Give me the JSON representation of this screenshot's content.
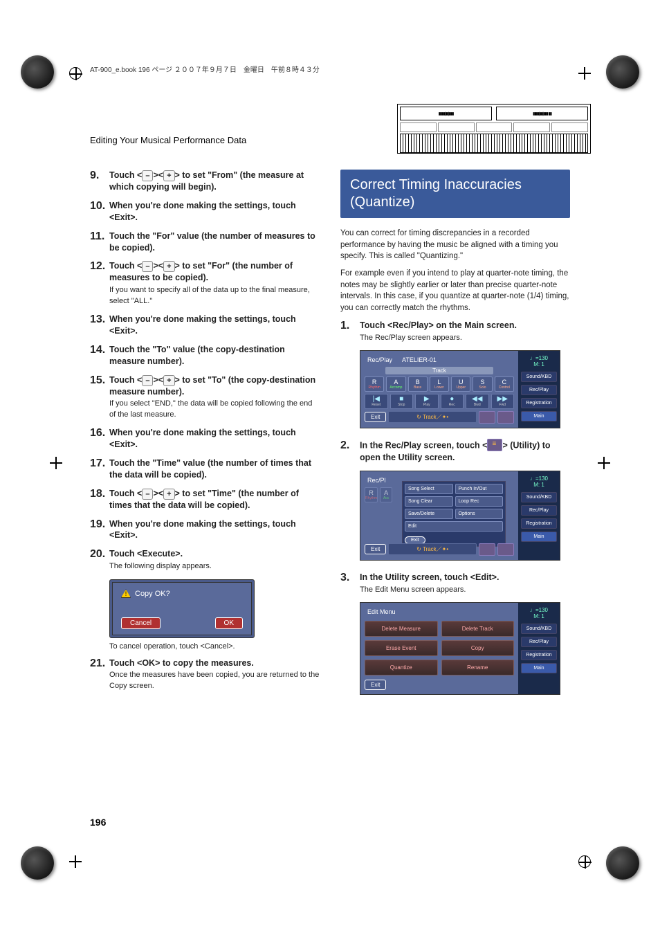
{
  "header": "AT-900_e.book  196 ページ  ２００７年９月７日　金曜日　午前８時４３分",
  "sectionTitle": "Editing Your Musical Performance Data",
  "pageNumber": "196",
  "left": {
    "steps": {
      "s9": {
        "num": "9.",
        "bold": "Touch < – >< + > to set \"From\" (the measure at which copying will begin)."
      },
      "s10": {
        "num": "10.",
        "bold": "When you're done making the settings, touch <Exit>."
      },
      "s11": {
        "num": "11.",
        "bold": "Touch the \"For\" value (the number of measures to be copied)."
      },
      "s12": {
        "num": "12.",
        "bold": "Touch < – >< + > to set \"For\" (the number of measures to be copied).",
        "note": "If you want to specify all of the data up to the final measure, select \"ALL.\""
      },
      "s13": {
        "num": "13.",
        "bold": "When you're done making the settings, touch <Exit>."
      },
      "s14": {
        "num": "14.",
        "bold": "Touch the \"To\" value (the copy-destination measure number)."
      },
      "s15": {
        "num": "15.",
        "bold": "Touch < – >< + > to set \"To\" (the copy-destination measure number).",
        "note": "If you select \"END,\" the data will be copied following the end of the last measure."
      },
      "s16": {
        "num": "16.",
        "bold": "When you're done making the settings, touch <Exit>."
      },
      "s17": {
        "num": "17.",
        "bold": "Touch the \"Time\" value (the number of times that the data will be copied)."
      },
      "s18": {
        "num": "18.",
        "bold": "Touch < – >< + > to set \"Time\" (the number of times that the data will be copied)."
      },
      "s19": {
        "num": "19.",
        "bold": "When you're done making the settings, touch <Exit>."
      },
      "s20": {
        "num": "20.",
        "bold": "Touch <Execute>.",
        "caption": "The following display appears."
      },
      "s21": {
        "num": "21.",
        "bold": "Touch <OK> to copy the measures.",
        "note": "Once the measures have been copied, you are returned to the Copy screen."
      }
    },
    "dialog": {
      "title": "Copy OK?",
      "cancel": "Cancel",
      "ok": "OK",
      "cancelCaption": "To cancel operation, touch <Cancel>."
    }
  },
  "right": {
    "heading": "Correct Timing Inaccuracies (Quantize)",
    "para1": "You can correct for timing discrepancies in a recorded performance by having the music be aligned with a timing you specify. This is called \"Quantizing.\"",
    "para2": "For example even if you intend to play at quarter-note timing, the notes may be slightly earlier or later than precise quarter-note intervals. In this case, if you quantize at quarter-note (1/4) timing, you can correctly match the rhythms.",
    "steps": {
      "s1": {
        "num": "1.",
        "bold": "Touch <Rec/Play> on the Main screen.",
        "caption": "The Rec/Play screen appears."
      },
      "s2": {
        "num": "2.",
        "boldA": "In the Rec/Play screen, touch <",
        "boldB": "> (Utility) to open the Utility screen."
      },
      "s3": {
        "num": "3.",
        "bold": "In the Utility screen, touch <Edit>.",
        "caption": "The Edit Menu screen appears."
      }
    }
  },
  "ss1": {
    "title1": "Rec/Play",
    "title2": "ATELIER-01",
    "trackHdr": "Track",
    "tracks": [
      {
        "l": "R",
        "n": "Rhythm"
      },
      {
        "l": "A",
        "n": "Accomp"
      },
      {
        "l": "B",
        "n": "Bass"
      },
      {
        "l": "L",
        "n": "Lower"
      },
      {
        "l": "U",
        "n": "Upper"
      },
      {
        "l": "S",
        "n": "Solo"
      },
      {
        "l": "C",
        "n": "Control"
      }
    ],
    "transport": [
      {
        "i": "|◀",
        "n": "Reset"
      },
      {
        "i": "■",
        "n": "Stop"
      },
      {
        "i": "▶",
        "n": "Play"
      },
      {
        "i": "●",
        "n": "Rec"
      },
      {
        "i": "◀◀",
        "n": "Bwd"
      },
      {
        "i": "▶▶",
        "n": "Fwd"
      }
    ],
    "exit": "Exit",
    "trackbar": "Track／",
    "side": {
      "tempo": "♩=130",
      "m": "M:    1",
      "a": "Sound/KBD",
      "b": "Rec/Play",
      "c": "Registration",
      "d": "Main"
    }
  },
  "ss2": {
    "title": "Rec/Pl",
    "util": [
      [
        "Song Select",
        "Punch In/Out"
      ],
      [
        "Song Clear",
        "Loop Rec"
      ],
      [
        "Save/Delete",
        "Options"
      ],
      [
        "Edit",
        ""
      ]
    ],
    "utilExit": "Exit"
  },
  "ss3": {
    "title": "Edit Menu",
    "grid": [
      "Delete Measure",
      "Delete Track",
      "Erase Event",
      "Copy",
      "Quantize",
      "Rename"
    ],
    "exit": "Exit"
  }
}
